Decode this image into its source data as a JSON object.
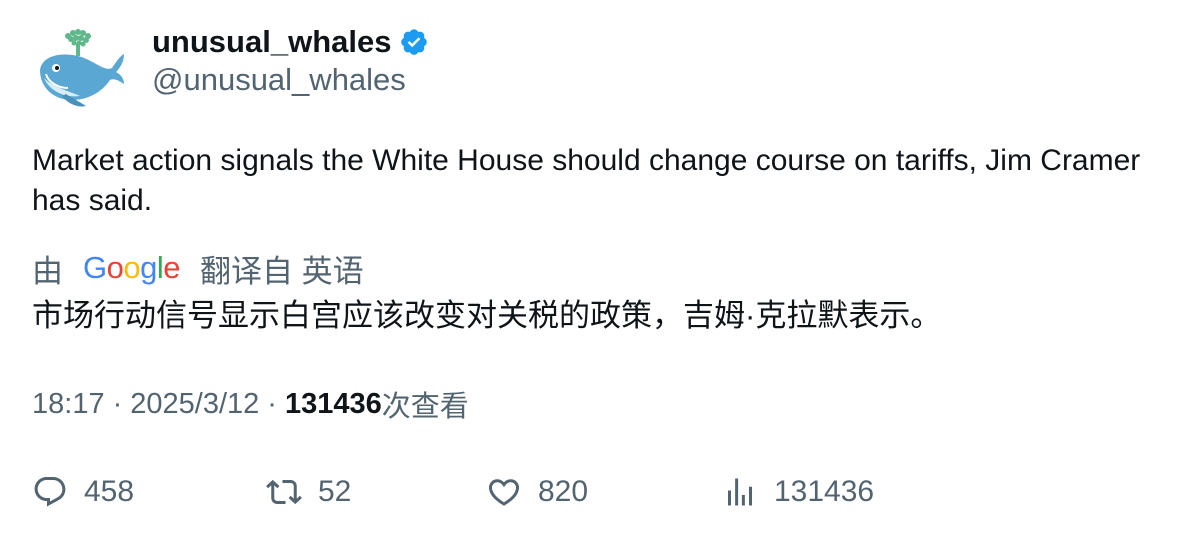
{
  "author": {
    "display_name": "unusual_whales",
    "handle": "@unusual_whales",
    "verified": true,
    "avatar_icon": "whale-avatar-icon"
  },
  "tweet": {
    "text": "Market action signals the White House should change course on tariffs, Jim Cramer has said."
  },
  "translation": {
    "prefix": "由",
    "provider_letters": [
      "G",
      "o",
      "o",
      "g",
      "l",
      "e"
    ],
    "suffix": "翻译自 英语",
    "text": "市场行动信号显示白宫应该改变对关税的政策，吉姆·克拉默表示。"
  },
  "meta": {
    "time": "18:17",
    "separator": "·",
    "date": "2025/3/12",
    "views_count": "131436",
    "views_label": "次查看"
  },
  "actions": {
    "replies": "458",
    "retweets": "52",
    "likes": "820",
    "views": "131436"
  },
  "colors": {
    "text_primary": "#0f1419",
    "text_secondary": "#536471",
    "verified_blue": "#1d9bf0"
  }
}
